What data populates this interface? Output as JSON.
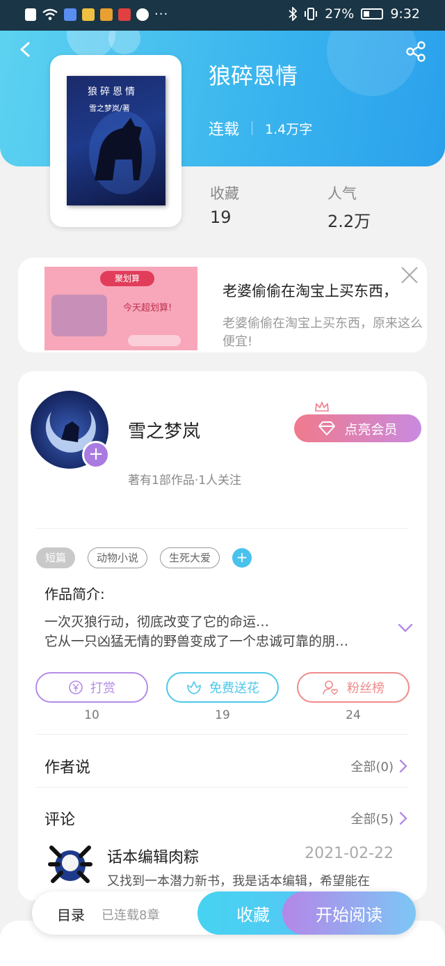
{
  "status_bar": {
    "battery": "27%",
    "time": "9:32",
    "dots": "···"
  },
  "book": {
    "title": "狼碎恩情",
    "status": "连载",
    "word_count": "1.4万字",
    "cover_title": "狼碎恩情",
    "cover_author": "雪之梦岚/著",
    "collect_label": "收藏",
    "collect_value": "19",
    "popularity_label": "人气",
    "popularity_value": "2.2万"
  },
  "ad": {
    "image_tag": "聚划算",
    "image_headline": "今天超划算!",
    "title": "老婆偷偷在淘宝上买东西，",
    "description": "老婆偷偷在淘宝上买东西，原来这么便宜!"
  },
  "author": {
    "name": "雪之梦岚",
    "meta": "著有1部作品·1人关注",
    "vip_label": "点亮会员"
  },
  "tags": [
    "短篇",
    "动物小说",
    "生死大爱"
  ],
  "intro": {
    "title": "作品简介:",
    "line1": "一次灭狼行动，彻底改变了它的命运…",
    "line2": "它从一只凶猛无情的野兽变成了一个忠诚可靠的朋…"
  },
  "actions": {
    "reward_label": "打赏",
    "reward_count": "10",
    "flower_label": "免费送花",
    "flower_count": "19",
    "fans_label": "粉丝榜",
    "fans_count": "24"
  },
  "author_says": {
    "title": "作者说",
    "more": "全部(0)"
  },
  "comments": {
    "title": "评论",
    "more": "全部(5)",
    "first": {
      "name": "话本编辑肉粽",
      "date": "2021-02-22",
      "text": "又找到一本潜力新书，我是话本编辑，希望能在"
    }
  },
  "bottom_bar": {
    "toc_label": "目录",
    "chapters": "已连载8章",
    "favorite_label": "收藏",
    "read_label": "开始阅读"
  },
  "colors": {
    "header_blue": "#3bb6ee",
    "reward_purple": "#b48be8",
    "flower_cyan": "#4cc8e8",
    "fans_red": "#f08a8a"
  }
}
